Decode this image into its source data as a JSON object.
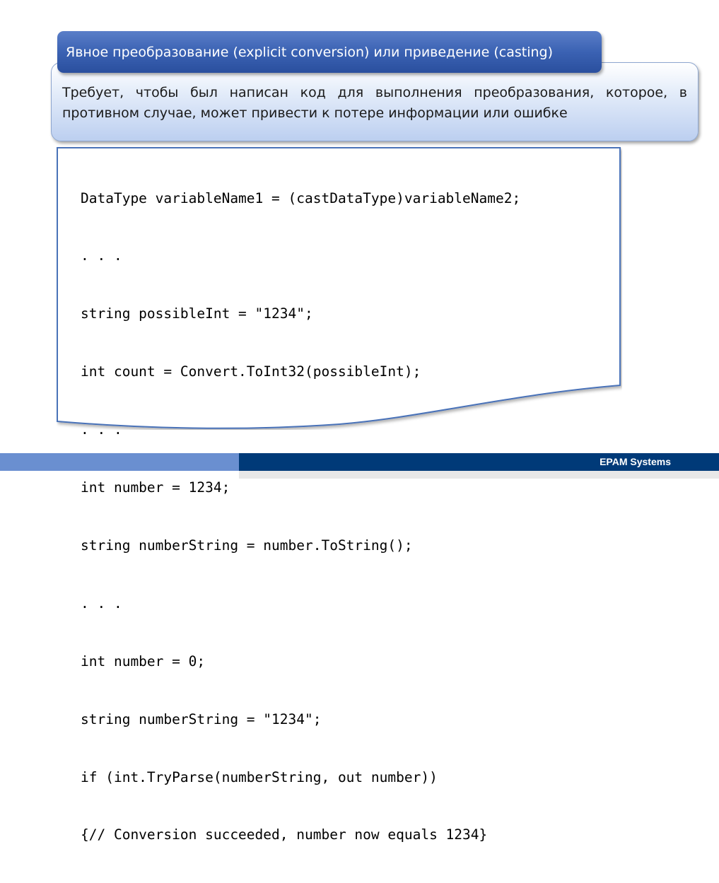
{
  "slide": {
    "title": "Явное преобразование (explicit conversion) или приведение (casting)",
    "description": "Требует, чтобы был написан код для выполнения преобразования, которое, в противном случае, может привести к потере информации или ошибке",
    "code_lines": [
      "DataType variableName1 = (castDataType)variableName2;",
      ". . .",
      "string possibleInt = \"1234\";",
      "int count = Convert.ToInt32(possibleInt);",
      ". . .",
      "int number = 1234;",
      "string numberString = number.ToString();",
      ". . .",
      "int number = 0;",
      "string numberString = \"1234\";",
      "if (int.TryParse(numberString, out number))",
      "{// Conversion succeeded, number now equals 1234}"
    ]
  },
  "footer": {
    "brand": "EPAM Systems"
  },
  "colors": {
    "title_bg": "#3b62b3",
    "footer_dark": "#003a78",
    "footer_light": "#6a8fd0",
    "code_border": "#4a72b8"
  }
}
